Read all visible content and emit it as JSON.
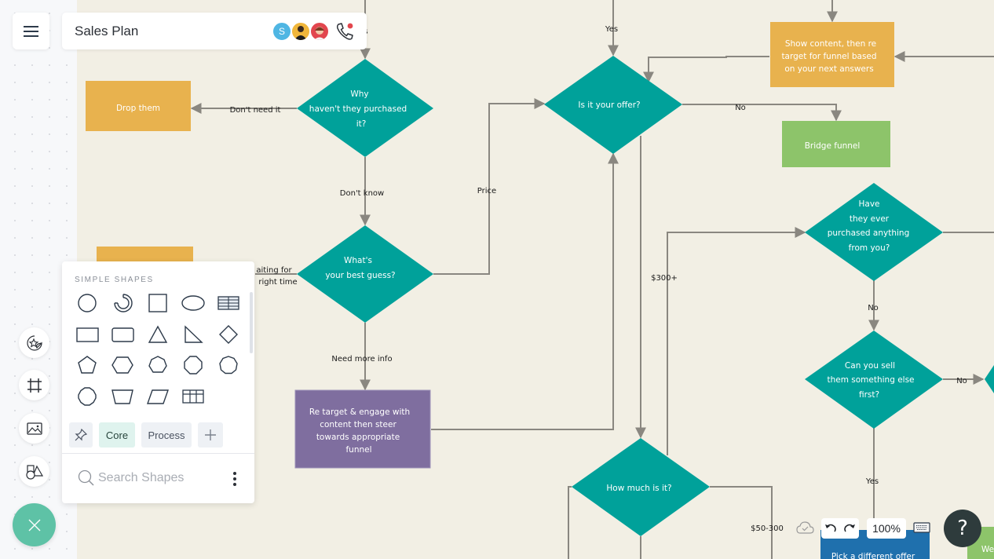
{
  "app": {
    "document_title": "Sales Plan",
    "collaborators": [
      {
        "initial": "S",
        "color": "#4fb6e3"
      },
      {
        "initial": "",
        "color": "#f0b63a"
      },
      {
        "initial": "",
        "color": "#e2464e"
      }
    ]
  },
  "shapes_panel": {
    "heading": "SIMPLE SHAPES",
    "shapes": [
      "circle",
      "partial-circle",
      "square",
      "ellipse",
      "table",
      "rectangle",
      "rounded-rectangle",
      "triangle",
      "right-triangle",
      "diamond",
      "pentagon",
      "hexagon",
      "heptagon",
      "octagon",
      "nonagon",
      "decagon",
      "trapezoid",
      "parallelogram",
      "grid-table"
    ],
    "tabs": [
      {
        "label": "",
        "icon": "pin-icon"
      },
      {
        "label": "Core",
        "active": true
      },
      {
        "label": "Process"
      },
      {
        "label": "",
        "icon": "plus-icon"
      }
    ],
    "search_placeholder": "Search Shapes"
  },
  "left_tools": [
    "sticker-icon",
    "frame-icon",
    "image-icon",
    "shapes-icon"
  ],
  "bottom_bar": {
    "zoom_level": "100%",
    "help_label": "?"
  },
  "diagram": {
    "colors": {
      "decision": "#00a19a",
      "action_orange": "#e8b24e",
      "action_green": "#8dc46a",
      "action_purple": "#7f6e9f",
      "action_blue": "#1f70ad",
      "connector": "#8a8780"
    },
    "nodes": [
      {
        "id": "why",
        "type": "decision",
        "lines": [
          "Why",
          "haven't they purchased",
          "it?"
        ]
      },
      {
        "id": "drop",
        "type": "process",
        "lines": [
          "Drop them"
        ]
      },
      {
        "id": "best_guess",
        "type": "decision",
        "lines": [
          "What's",
          "your best guess?"
        ]
      },
      {
        "id": "retarget",
        "type": "process",
        "lines": [
          "Re target & engage with",
          "content then steer",
          "towards appropriate",
          "funnel"
        ]
      },
      {
        "id": "offer",
        "type": "decision",
        "lines": [
          "Is it your offer?"
        ]
      },
      {
        "id": "show_content",
        "type": "process",
        "lines": [
          "Show content, then re",
          "target for funnel based",
          "on your next answers"
        ]
      },
      {
        "id": "bridge",
        "type": "process",
        "lines": [
          "Bridge funnel"
        ]
      },
      {
        "id": "ever_purchased",
        "type": "decision",
        "lines": [
          "Have",
          "they ever",
          "purchased anything",
          "from you?"
        ]
      },
      {
        "id": "sell_else",
        "type": "decision",
        "lines": [
          "Can you sell",
          "them something else",
          "first?"
        ]
      },
      {
        "id": "how_much",
        "type": "decision",
        "lines": [
          "How much is it?"
        ]
      },
      {
        "id": "pick_offer",
        "type": "process",
        "lines": [
          "Pick a different offer"
        ]
      },
      {
        "id": "we",
        "type": "process",
        "lines": [
          "We"
        ]
      },
      {
        "id": "top_left_orange",
        "type": "process",
        "lines": [
          ""
        ]
      }
    ],
    "edge_labels": {
      "dont_need": "Don't need it",
      "dont_know": "Don't know",
      "waiting_1": "aiting for",
      "waiting_2": "right time",
      "need_more": "Need more info",
      "price": "Price",
      "yes_top": "Yes",
      "no_bridge": "No",
      "over_300": "$300+",
      "no_ever": "No",
      "no_sell": "No",
      "yes_sell": "Yes",
      "range_50_300": "$50-300"
    },
    "header_fragment": "s"
  }
}
